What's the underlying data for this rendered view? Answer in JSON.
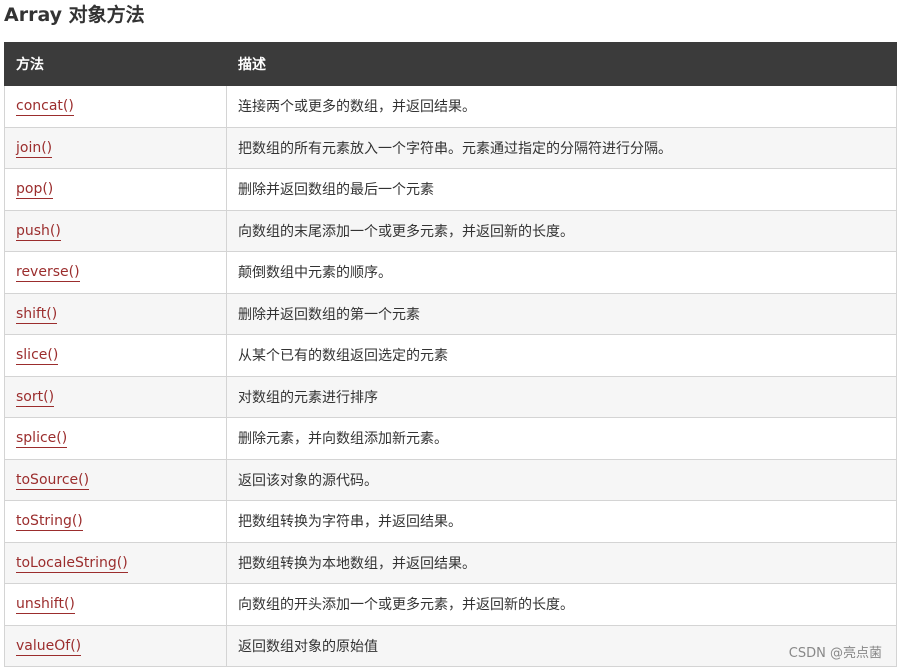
{
  "page": {
    "title": "Array 对象方法"
  },
  "table": {
    "headers": {
      "method": "方法",
      "description": "描述"
    },
    "rows": [
      {
        "method": "concat()",
        "description": "连接两个或更多的数组，并返回结果。"
      },
      {
        "method": "join()",
        "description": "把数组的所有元素放入一个字符串。元素通过指定的分隔符进行分隔。"
      },
      {
        "method": "pop()",
        "description": "删除并返回数组的最后一个元素"
      },
      {
        "method": "push()",
        "description": "向数组的末尾添加一个或更多元素，并返回新的长度。"
      },
      {
        "method": "reverse()",
        "description": "颠倒数组中元素的顺序。"
      },
      {
        "method": "shift()",
        "description": "删除并返回数组的第一个元素"
      },
      {
        "method": "slice()",
        "description": "从某个已有的数组返回选定的元素"
      },
      {
        "method": "sort()",
        "description": "对数组的元素进行排序"
      },
      {
        "method": "splice()",
        "description": "删除元素，并向数组添加新元素。"
      },
      {
        "method": "toSource()",
        "description": "返回该对象的源代码。"
      },
      {
        "method": "toString()",
        "description": "把数组转换为字符串，并返回结果。"
      },
      {
        "method": "toLocaleString()",
        "description": "把数组转换为本地数组，并返回结果。"
      },
      {
        "method": "unshift()",
        "description": "向数组的开头添加一个或更多元素，并返回新的长度。"
      },
      {
        "method": "valueOf()",
        "description": "返回数组对象的原始值"
      }
    ]
  },
  "watermark": "CSDN @亮点菌",
  "colors": {
    "header_bg": "#3b3b3b",
    "link": "#9b2d2d",
    "row_alt_bg": "#f6f6f6",
    "border": "#d4d4d4"
  }
}
